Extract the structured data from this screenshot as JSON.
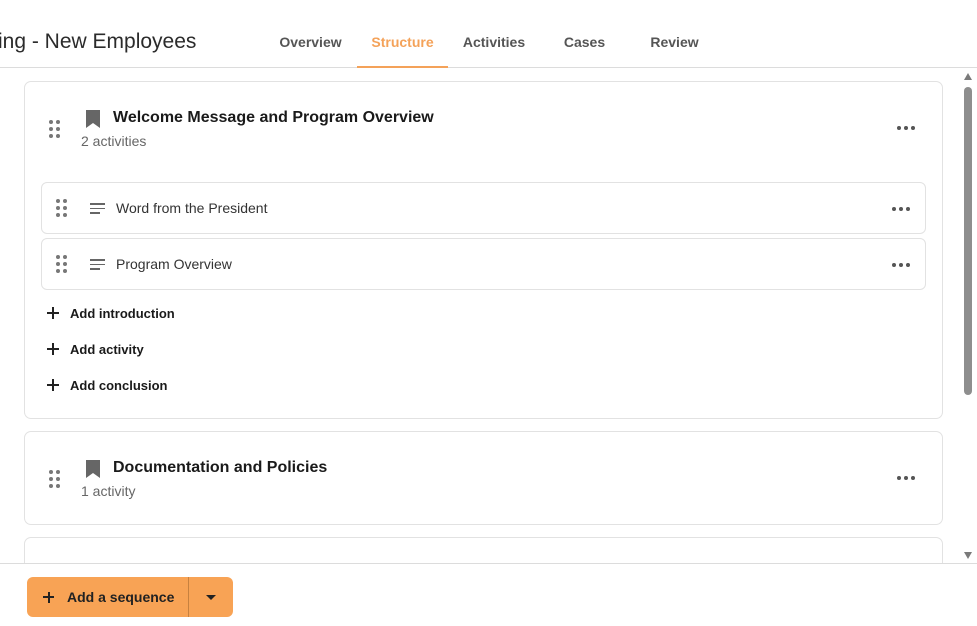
{
  "header": {
    "title": "ing - New Employees",
    "tabs": [
      {
        "label": "Overview",
        "active": false
      },
      {
        "label": "Structure",
        "active": true
      },
      {
        "label": "Activities",
        "active": false
      },
      {
        "label": "Cases",
        "active": false
      },
      {
        "label": "Review",
        "active": false
      }
    ]
  },
  "colors": {
    "accent": "#f4a259",
    "primary_button": "#f8a355"
  },
  "sequences": [
    {
      "title": "Welcome Message and Program Overview",
      "count": "2 activities",
      "icon": "bookmark-icon",
      "activities": [
        {
          "label": "Word from the President",
          "icon": "text-lines-icon"
        },
        {
          "label": "Program Overview",
          "icon": "text-lines-icon"
        }
      ],
      "add_links": [
        {
          "label": "Add introduction"
        },
        {
          "label": "Add activity"
        },
        {
          "label": "Add conclusion"
        }
      ]
    },
    {
      "title": "Documentation and Policies",
      "count": "1 activity",
      "icon": "bookmark-icon"
    }
  ],
  "footer": {
    "add_sequence_label": "Add a sequence"
  }
}
